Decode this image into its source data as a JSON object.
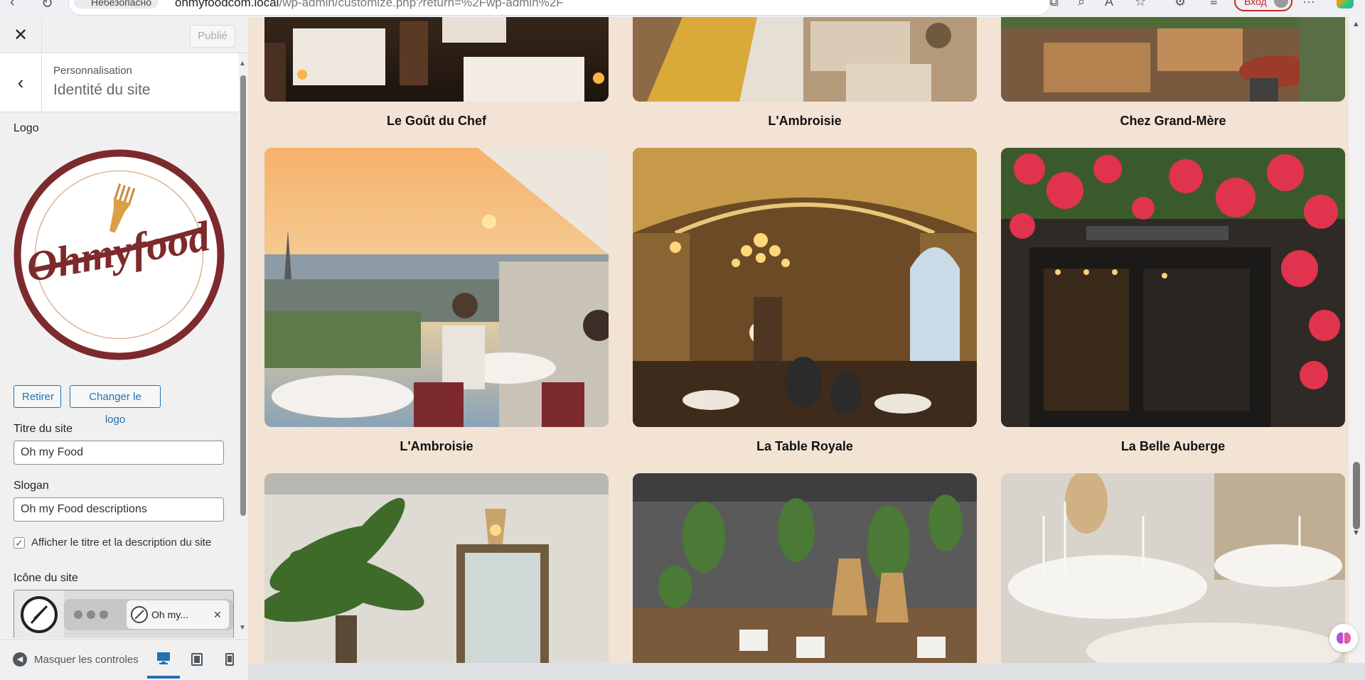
{
  "browser": {
    "site_pill": "Небезопасно",
    "url_host": "ohmyfoodcom.local",
    "url_path": "/wp-admin/customize.php?return=%2Fwp-admin%2F",
    "login_label": "Вход"
  },
  "customizer": {
    "publish_label": "Publié",
    "breadcrumb": "Personnalisation",
    "section_title": "Identité du site",
    "logo_label": "Logo",
    "logo_text": "Ohmyfood",
    "remove_button": "Retirer",
    "change_logo_button": "Changer le logo",
    "site_title_label": "Titre du site",
    "site_title_value": "Oh my Food",
    "tagline_label": "Slogan",
    "tagline_value": "Oh my Food descriptions",
    "display_checkbox_label": "Afficher le titre et la description du site",
    "display_checkbox_checked": true,
    "site_icon_label": "Icône du site",
    "site_icon_tab_title": "Oh my...",
    "hide_controls_label": "Masquer les controles"
  },
  "restaurants": [
    {
      "name": "Le Goût du Chef",
      "scene": "candlelit-terrace"
    },
    {
      "name": "L'Ambroisie",
      "scene": "long-banquette-room"
    },
    {
      "name": "Chez Grand-Mère",
      "scene": "wooden-terrace"
    },
    {
      "name": "L'Ambroisie",
      "scene": "rooftop-sunset-paris"
    },
    {
      "name": "La Table Royale",
      "scene": "gilded-hall-chandelier"
    },
    {
      "name": "La Belle Auberge",
      "scene": "flower-facade"
    },
    {
      "name": "",
      "scene": "palm-courtyard"
    },
    {
      "name": "",
      "scene": "green-wall-bar"
    },
    {
      "name": "",
      "scene": "white-banquet"
    }
  ],
  "colors": {
    "preview_background": "#f2e3d5",
    "wp_accent": "#2271b1",
    "logo_red": "#7d2a2d",
    "login_red": "#c62828"
  }
}
